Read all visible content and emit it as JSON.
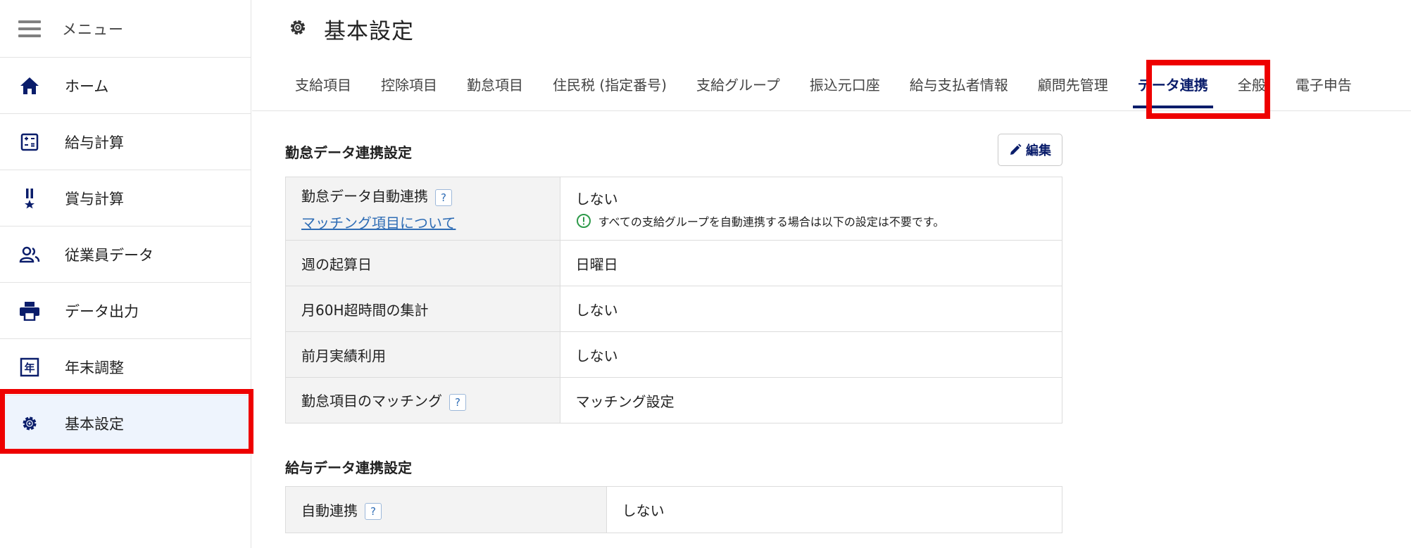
{
  "sidebar": {
    "menu_label": "メニュー",
    "items": [
      {
        "label": "ホーム",
        "icon": "home-icon"
      },
      {
        "label": "給与計算",
        "icon": "calculator-icon"
      },
      {
        "label": "賞与計算",
        "icon": "medal-icon"
      },
      {
        "label": "従業員データ",
        "icon": "people-icon"
      },
      {
        "label": "データ出力",
        "icon": "printer-icon"
      },
      {
        "label": "年末調整",
        "icon": "year-icon",
        "icon_glyph": "年"
      },
      {
        "label": "基本設定",
        "icon": "gear-icon",
        "active": true
      }
    ]
  },
  "header": {
    "title": "基本設定",
    "icon": "gear-icon"
  },
  "tabs": [
    {
      "label": "支給項目"
    },
    {
      "label": "控除項目"
    },
    {
      "label": "勤怠項目"
    },
    {
      "label": "住民税 (指定番号)"
    },
    {
      "label": "支給グループ"
    },
    {
      "label": "振込元口座"
    },
    {
      "label": "給与支払者情報"
    },
    {
      "label": "顧問先管理"
    },
    {
      "label": "データ連携",
      "active": true
    },
    {
      "label": "全般"
    },
    {
      "label": "電子申告"
    }
  ],
  "attendance": {
    "title": "勤怠データ連携設定",
    "edit_label": "編集",
    "rows": {
      "auto_link": {
        "label": "勤怠データ自動連携",
        "link": "マッチング項目について",
        "value": "しない",
        "note": "すべての支給グループを自動連携する場合は以下の設定は不要です。"
      },
      "week_start": {
        "label": "週の起算日",
        "value": "日曜日"
      },
      "overtime_60h": {
        "label": "月60H超時間の集計",
        "value": "しない"
      },
      "prev_month": {
        "label": "前月実績利用",
        "value": "しない"
      },
      "matching": {
        "label": "勤怠項目のマッチング",
        "value": "マッチング設定"
      }
    }
  },
  "payroll": {
    "title": "給与データ連携設定",
    "rows": {
      "auto_link": {
        "label": "自動連携",
        "value": "しない"
      }
    }
  },
  "colors": {
    "accent": "#0a1d6b",
    "highlight": "#ee0000",
    "link": "#2f6db5",
    "active_bg": "#eef4fd"
  }
}
